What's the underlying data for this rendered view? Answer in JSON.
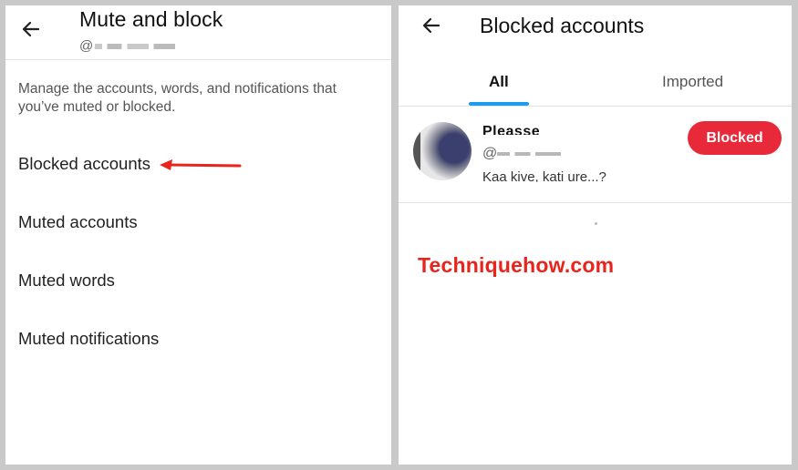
{
  "left": {
    "title": "Mute and block",
    "handle_prefix": "@",
    "description": "Manage the accounts, words, and notifications that you’ve muted or blocked.",
    "items": [
      {
        "label": "Blocked accounts"
      },
      {
        "label": "Muted accounts"
      },
      {
        "label": "Muted words"
      },
      {
        "label": "Muted notifications"
      }
    ],
    "back_icon": "arrow-left-icon"
  },
  "right": {
    "title": "Blocked accounts",
    "back_icon": "arrow-left-icon",
    "tabs": [
      {
        "label": "All",
        "selected": true
      },
      {
        "label": "Imported",
        "selected": false
      }
    ],
    "user": {
      "name": "Pleasse",
      "handle_prefix": "@",
      "bio": "Kaa kive, kati ure...?",
      "button_label": "Blocked"
    },
    "watermark": "Techniquehow.com"
  },
  "colors": {
    "accent": "#1d9bf0",
    "blocked": "#e8293a",
    "annotation": "#e8241c",
    "frame": "#c9c9c9"
  }
}
